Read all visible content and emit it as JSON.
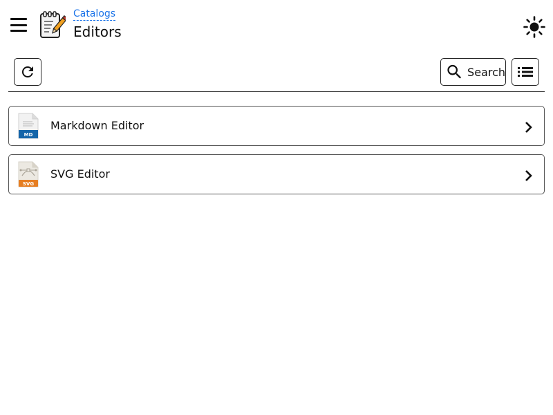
{
  "header": {
    "menu_icon": "hamburger-menu-icon",
    "app_icon": "notepad-pencil-icon",
    "breadcrumb": "Catalogs",
    "title": "Editors",
    "theme_icon": "sun-icon"
  },
  "toolbar": {
    "refresh_icon": "refresh-icon",
    "search_icon": "search-icon",
    "search_label": "Search",
    "view_icon": "list-view-icon"
  },
  "items": [
    {
      "label": "Markdown Editor",
      "icon": "markdown-file-icon",
      "badge": "MD",
      "badge_color": "#1565a9"
    },
    {
      "label": "SVG Editor",
      "icon": "svg-file-icon",
      "badge": "SVG",
      "badge_color": "#e67e22"
    }
  ],
  "colors": {
    "link": "#1a73e8",
    "border": "#555555"
  }
}
